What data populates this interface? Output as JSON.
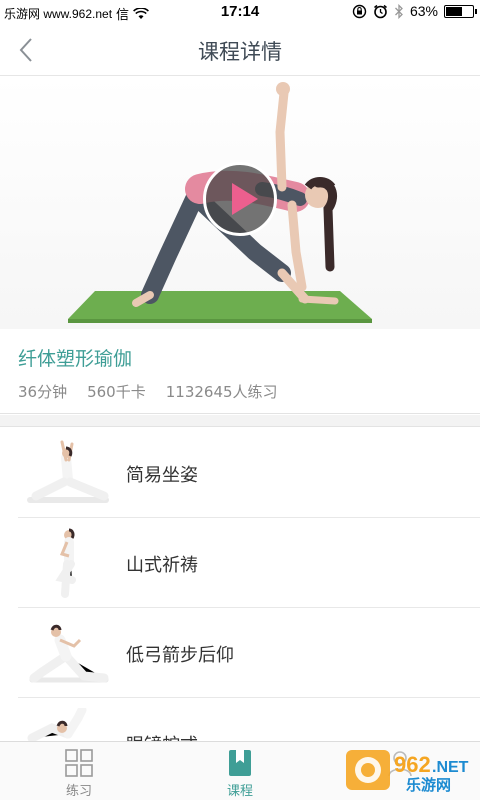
{
  "status_bar": {
    "carrier": "乐游网 www.962.net",
    "carrier_suffix": "信",
    "time": "17:14",
    "battery_percent": "63%",
    "battery_level": 0.63
  },
  "nav": {
    "title": "课程详情",
    "back_icon": "chevron-left-icon"
  },
  "course": {
    "name": "纤体塑形瑜伽",
    "duration": "36分钟",
    "calories": "560千卡",
    "practitioners": "1132645人练习"
  },
  "poses": [
    {
      "label": "简易坐姿"
    },
    {
      "label": "山式祈祷"
    },
    {
      "label": "低弓箭步后仰"
    },
    {
      "label": "眼镜蛇式"
    }
  ],
  "tabs": {
    "practice": "练习",
    "course": "课程"
  },
  "watermark": {
    "number": "962",
    "net": ".NET",
    "site": "乐游网"
  },
  "colors": {
    "accent": "#3f9e96",
    "title": "#3f4a55",
    "meta": "#8a8a8a"
  }
}
